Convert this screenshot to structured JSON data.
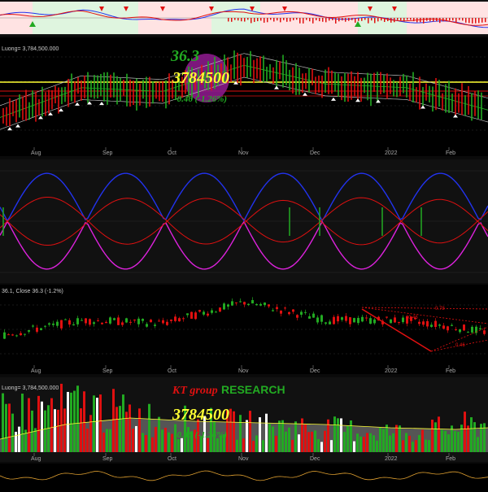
{
  "months": [
    "Aug",
    "Sep",
    "Oct",
    "Nov",
    "Dec",
    "2022",
    "Feb"
  ],
  "overlay": {
    "price": "36.3",
    "volume": "3784500",
    "change": "-0.46 (-1.26%)",
    "brand_left": "KT group",
    "brand_right": "RESEARCH",
    "volume2": "3784500",
    "change2": "-0.46 (-1.26%)"
  },
  "panels": {
    "price_label": "Luong= 3,784,500.000",
    "candle_label": "36.1, Close 36.3 (-1.2%)",
    "volume_label": "Luong= 3,784,500.000"
  },
  "annotations": {
    "fib": [
      "0.78",
      "0.46",
      "0.46"
    ]
  },
  "colors": {
    "up": "#22aa22",
    "down": "#e01010",
    "yellow": "#ffff33",
    "magenta": "#dd22dd",
    "blue": "#2233ee",
    "orange": "#e0a030",
    "signal_bg": "#ffe3e3",
    "signal_bg2": "#dff5df"
  },
  "chart_data": [
    {
      "type": "line",
      "panel": "signal",
      "x": [
        "Aug",
        "Sep",
        "Oct",
        "Nov",
        "Dec",
        "2022",
        "Feb"
      ],
      "series": [
        {
          "values": [
            0.2,
            0.5,
            -0.3,
            0.6,
            0.1,
            -0.2,
            -0.6
          ]
        },
        {
          "values": [
            0.1,
            0.4,
            -0.2,
            0.5,
            0.2,
            -0.1,
            -0.5
          ]
        }
      ]
    },
    {
      "type": "line",
      "panel": "price",
      "x": [
        "Aug",
        "Sep",
        "Oct",
        "Nov",
        "Dec",
        "2022",
        "Feb"
      ],
      "values": [
        31.0,
        35.0,
        34.5,
        38.0,
        35.5,
        35.0,
        32.0
      ],
      "last": 36.3
    },
    {
      "type": "line",
      "panel": "oscillator",
      "x": [
        "Aug",
        "Sep",
        "Oct",
        "Nov",
        "Dec",
        "2022",
        "Feb"
      ],
      "series": [
        {
          "values": [
            0.0,
            0.9,
            -0.9,
            0.9,
            0.6,
            0.0,
            0.9
          ]
        },
        {
          "values": [
            0.0,
            -0.9,
            0.9,
            -0.9,
            -0.6,
            0.0,
            -0.9
          ]
        }
      ]
    },
    {
      "type": "bar",
      "panel": "candles",
      "x": [
        "Aug",
        "Sep",
        "Oct",
        "Nov",
        "Dec",
        "2022",
        "Feb"
      ],
      "values": [
        33.0,
        35.5,
        35.0,
        38.5,
        35.5,
        35.5,
        33.5
      ],
      "last_close": 36.3
    },
    {
      "type": "bar",
      "panel": "volume",
      "x": [
        "Aug",
        "Sep",
        "Oct",
        "Nov",
        "Dec",
        "2022",
        "Feb"
      ],
      "values": [
        5.0,
        6.0,
        4.0,
        3.5,
        3.0,
        2.5,
        3.7
      ],
      "last": 3784500
    }
  ]
}
